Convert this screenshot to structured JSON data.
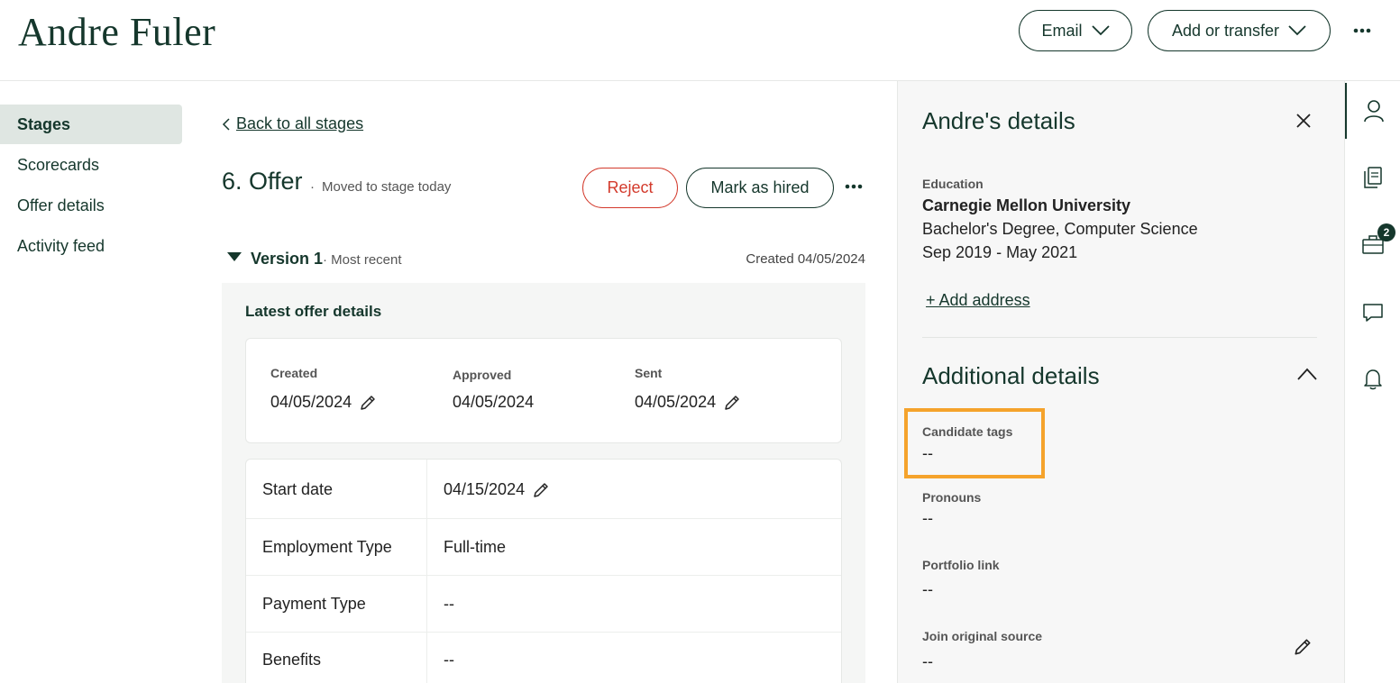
{
  "header": {
    "candidate_name": "Andre Fuler",
    "email_label": "Email",
    "add_transfer_label": "Add or transfer"
  },
  "left_nav": {
    "items": [
      {
        "label": "Stages",
        "active": true
      },
      {
        "label": "Scorecards",
        "active": false
      },
      {
        "label": "Offer details",
        "active": false
      },
      {
        "label": "Activity feed",
        "active": false
      }
    ]
  },
  "stage": {
    "back_label": "Back to all stages",
    "title": "6. Offer",
    "dot": "·",
    "subtitle": "Moved to stage today",
    "reject_label": "Reject",
    "hired_label": "Mark as hired"
  },
  "version": {
    "label": "Version 1",
    "sub": "· Most recent",
    "created": "Created 04/05/2024"
  },
  "offer": {
    "heading": "Latest offer details",
    "dates": [
      {
        "label": "Created",
        "value": "04/05/2024",
        "editable": true
      },
      {
        "label": "Approved",
        "value": "04/05/2024",
        "editable": false
      },
      {
        "label": "Sent",
        "value": "04/05/2024",
        "editable": true
      }
    ],
    "fields": [
      {
        "label": "Start date",
        "value": "04/15/2024",
        "editable": true
      },
      {
        "label": "Employment Type",
        "value": "Full-time",
        "editable": false
      },
      {
        "label": "Payment Type",
        "value": "--",
        "editable": false
      },
      {
        "label": "Benefits",
        "value": "--",
        "editable": false
      }
    ]
  },
  "details": {
    "title": "Andre's details",
    "education_label": "Education",
    "school": "Carnegie Mellon University",
    "degree": "Bachelor's Degree, Computer Science",
    "dates": "Sep 2019 - May 2021",
    "add_address": "+ Add address",
    "additional_title": "Additional details",
    "candidate_tags_label": "Candidate tags",
    "candidate_tags_value": "--",
    "pronouns_label": "Pronouns",
    "pronouns_value": "--",
    "portfolio_label": "Portfolio link",
    "portfolio_value": "--",
    "source_label": "Join original source",
    "source_value": "--"
  },
  "rail": {
    "jobs_badge": "2",
    "icons": [
      "person-icon",
      "documents-icon",
      "briefcase-icon",
      "chat-icon",
      "bell-icon"
    ]
  },
  "colors": {
    "brand": "#15372c",
    "reject": "#d33a2c",
    "highlight": "#f5a32c",
    "nav_active_bg": "#dfe6e2"
  }
}
